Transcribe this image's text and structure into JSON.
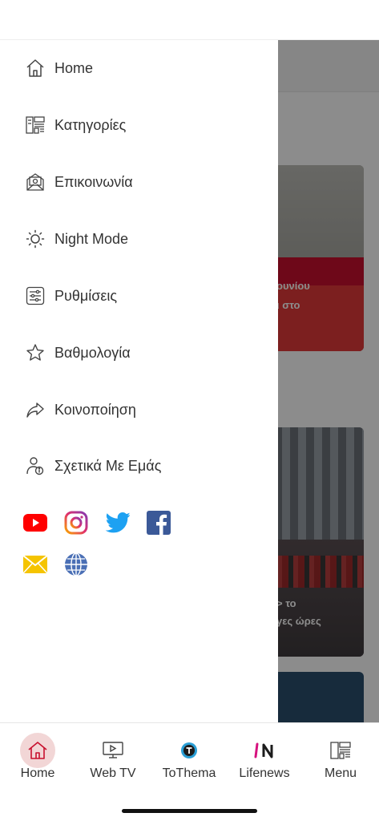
{
  "drawer": {
    "items": [
      {
        "label": "Home",
        "icon": "home-icon"
      },
      {
        "label": "Κατηγορίες",
        "icon": "categories-icon"
      },
      {
        "label": "Επικοινωνία",
        "icon": "contact-mail-icon"
      },
      {
        "label": "Night Mode",
        "icon": "sun-icon"
      },
      {
        "label": "Ρυθμίσεις",
        "icon": "settings-sliders-icon"
      },
      {
        "label": "Βαθμολογία",
        "icon": "star-icon"
      },
      {
        "label": "Κοινοποίηση",
        "icon": "share-icon"
      },
      {
        "label": "Σχετικά Με Εμάς",
        "icon": "about-user-icon"
      }
    ],
    "social": [
      "youtube-icon",
      "instagram-icon",
      "twitter-icon",
      "facebook-icon",
      "email-icon",
      "globe-icon"
    ]
  },
  "background": {
    "caption1_line1": "ουνίου",
    "caption1_line2": "ι στο",
    "caption2_line1": "> το",
    "caption2_line2": "γες ώρες"
  },
  "bottom_nav": {
    "tabs": [
      {
        "label": "Home",
        "icon": "home-icon",
        "active": true
      },
      {
        "label": "Web TV",
        "icon": "tv-play-icon",
        "active": false
      },
      {
        "label": "ToThema",
        "icon": "tothema-logo-icon",
        "active": false
      },
      {
        "label": "Lifenews",
        "icon": "lifenews-logo-icon",
        "active": false
      },
      {
        "label": "Menu",
        "icon": "menu-grid-icon",
        "active": false
      }
    ]
  },
  "colors": {
    "accent": "#c8102e",
    "active_tab_bg": "#f2d6d6",
    "youtube": "#ff0000",
    "twitter": "#1da1f2",
    "facebook": "#3b5998",
    "email": "#f5c400",
    "globe": "#4a6fb5"
  }
}
